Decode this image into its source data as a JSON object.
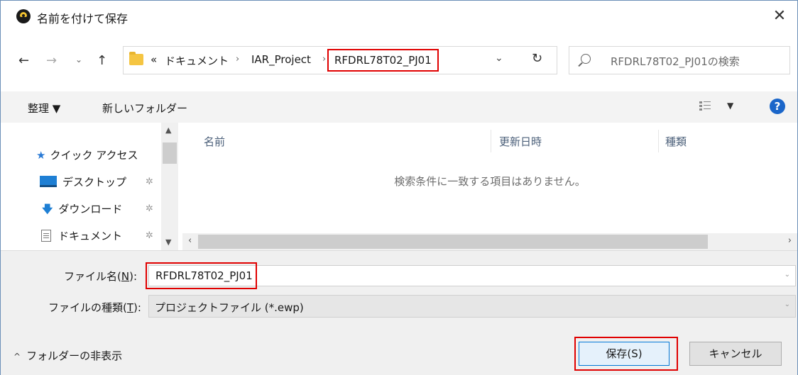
{
  "window": {
    "title": "名前を付けて保存",
    "close_glyph": "✕"
  },
  "nav": {
    "back_glyph": "←",
    "forward_glyph": "→",
    "recent_glyph": "⌄",
    "up_glyph": "↑",
    "breadcrumb": {
      "overflow": "«",
      "seg1": "ドキュメント",
      "sep": "›",
      "seg2": "IAR_Project",
      "current": "RFDRL78T02_PJ01"
    },
    "dropdown_glyph": "⌄",
    "refresh_glyph": "↻",
    "search_placeholder": "RFDRL78T02_PJ01の検索"
  },
  "toolbar": {
    "organize": "整理 ▼",
    "new_folder": "新しいフォルダー",
    "view_dropdown": "▼",
    "help": "?"
  },
  "navpane": {
    "quick_access": "クイック アクセス",
    "desktop": "デスクトップ",
    "downloads": "ダウンロード",
    "documents": "ドキュメント",
    "pin_glyph": "✲",
    "star_glyph": "★",
    "download_glyph": "🡇"
  },
  "filelist": {
    "col_name": "名前",
    "col_modified": "更新日時",
    "col_type": "種類",
    "empty_message": "検索条件に一致する項目はありません。"
  },
  "form": {
    "filename_label_pre": "ファイル名(",
    "filename_label_key": "N",
    "filename_label_post": "):",
    "filename_value": "RFDRL78T02_PJ01",
    "filetype_label_pre": "ファイルの種類(",
    "filetype_label_key": "T",
    "filetype_label_post": "):",
    "filetype_value": "プロジェクトファイル (*.ewp)",
    "hide_folders": "フォルダーの非表示",
    "save_label": "保存(S)",
    "cancel_label": "キャンセル"
  },
  "colors": {
    "highlight": "#e00000",
    "accent": "#0078d7"
  }
}
